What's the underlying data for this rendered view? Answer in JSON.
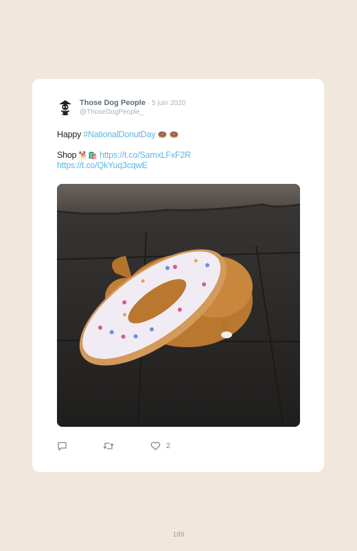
{
  "tweet": {
    "author_name": "Those Dog People",
    "date": "· 5 juin 2020",
    "handle": "@ThoseDogPeople_",
    "line1_prefix": "Happy ",
    "hashtag": "#NationalDonutDay",
    "line1_emoji": "🍩 🍩",
    "line2_prefix": "Shop ",
    "line2_emoji": "🐕🛍️",
    "link1": "https://t.co/SamxLFxF2R",
    "link2": "https://t.co/QkYuq3cqwE",
    "likes": "2"
  },
  "page_number": "189",
  "icons": {
    "reply": "reply-icon",
    "retweet": "retweet-icon",
    "like": "heart-icon"
  },
  "colors": {
    "background": "#f2e7dd",
    "card": "#ffffff",
    "link": "#5fb6e6",
    "name": "#5f6b77",
    "muted": "#a9b2bb"
  }
}
